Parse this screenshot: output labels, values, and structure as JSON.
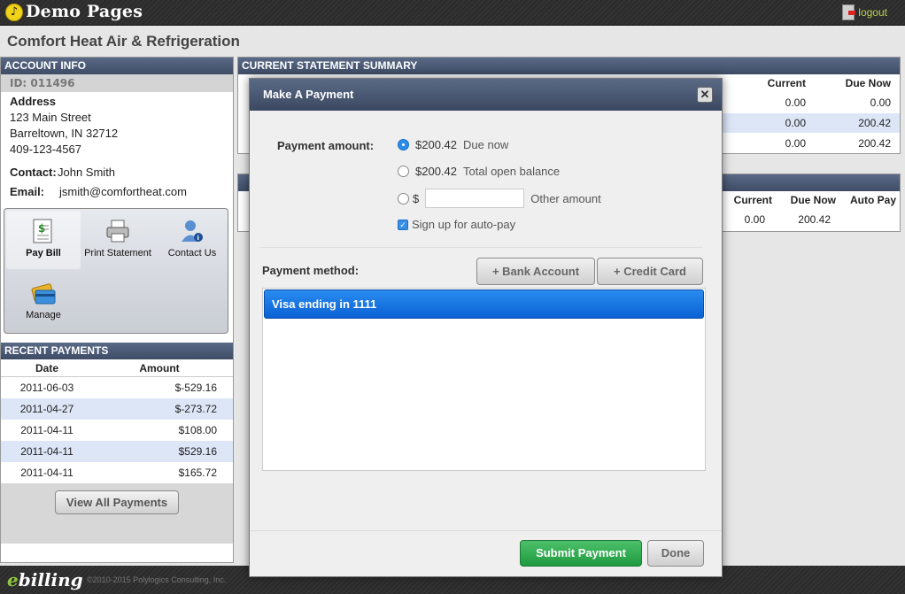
{
  "header": {
    "brand": "Demo Pages",
    "logo_letter": "♪",
    "logout_label": "logout"
  },
  "company_name": "Comfort Heat Air & Refrigeration",
  "account_info": {
    "title": "ACCOUNT INFO",
    "id": "ID: 011496",
    "address_label": "Address",
    "address_lines": [
      "123 Main Street",
      "Barreltown, IN 32712",
      "409-123-4567"
    ],
    "contact_label": "Contact:",
    "contact_value": "John Smith",
    "email_label": "Email:",
    "email_value": "jsmith@comfortheat.com"
  },
  "actions": [
    {
      "label": "Pay Bill",
      "icon": "bill-icon"
    },
    {
      "label": "Print Statement",
      "icon": "printer-icon"
    },
    {
      "label": "Contact Us",
      "icon": "contact-icon"
    },
    {
      "label": "Manage",
      "icon": "card-icon"
    }
  ],
  "recent_payments": {
    "title": "RECENT PAYMENTS",
    "col_date": "Date",
    "col_amount": "Amount",
    "rows": [
      {
        "date": "2011-06-03",
        "amount": "$-529.16"
      },
      {
        "date": "2011-04-27",
        "amount": "$-273.72"
      },
      {
        "date": "2011-04-11",
        "amount": "$108.00"
      },
      {
        "date": "2011-04-11",
        "amount": "$529.16"
      },
      {
        "date": "2011-04-11",
        "amount": "$165.72"
      }
    ],
    "view_all_label": "View All Payments"
  },
  "statement": {
    "title": "CURRENT STATEMENT SUMMARY",
    "col_current": "Current",
    "col_due_now": "Due Now",
    "rows": [
      {
        "current": "0.00",
        "due_now": "0.00"
      },
      {
        "current": "0.00",
        "due_now": "200.42"
      },
      {
        "current": "0.00",
        "due_now": "200.42"
      }
    ]
  },
  "statement2": {
    "col_current": "Current",
    "col_due_now": "Due Now",
    "col_auto_pay": "Auto Pay",
    "row": {
      "current": "0.00",
      "due_now": "200.42",
      "auto_pay": ""
    }
  },
  "modal": {
    "title": "Make A Payment",
    "close_glyph": "✕",
    "payment_amount_label": "Payment amount:",
    "options": [
      {
        "amount": "$200.42",
        "desc": "Due now",
        "selected": true
      },
      {
        "amount": "$200.42",
        "desc": "Total open balance",
        "selected": false
      },
      {
        "amount": "$",
        "desc": "Other amount",
        "selected": false
      }
    ],
    "other_amount_value": "",
    "autopay_label": "Sign up for auto-pay",
    "autopay_checked": true,
    "payment_method_label": "Payment method:",
    "bank_account_label": "+ Bank Account",
    "credit_card_label": "+ Credit Card",
    "methods": [
      "Visa ending in 1111"
    ],
    "submit_label": "Submit Payment",
    "done_label": "Done"
  },
  "footer": {
    "logo_e": "e",
    "logo_rest": "billing",
    "copyright": "©2010-2015 Polylogics Consulting, Inc."
  }
}
